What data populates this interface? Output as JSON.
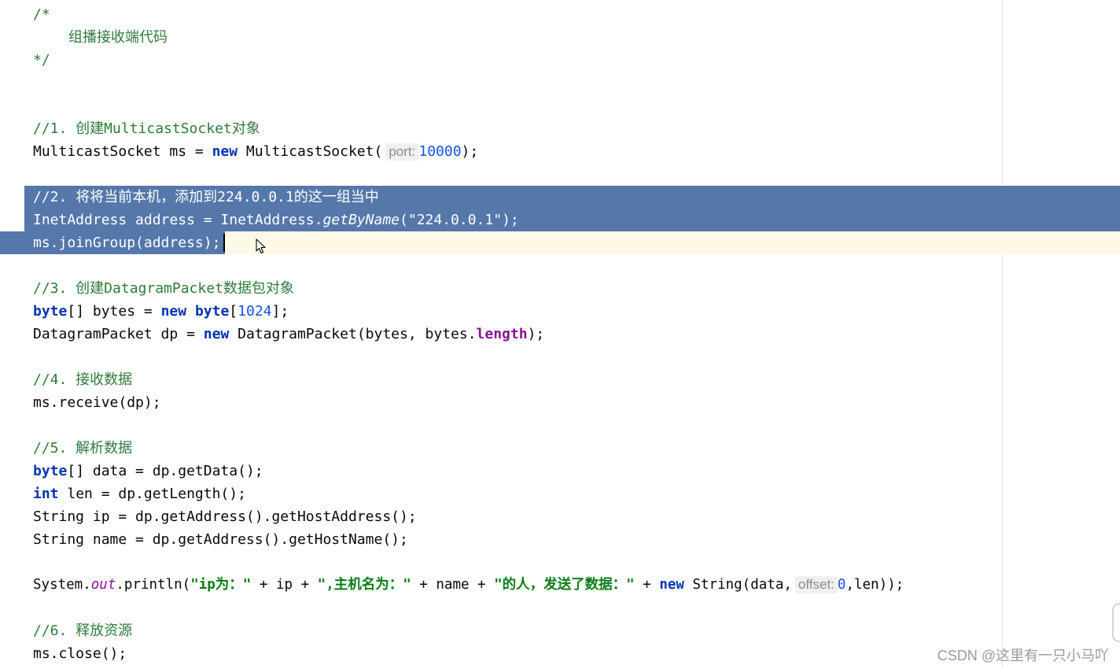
{
  "editor": {
    "lines": {
      "c_open": "/*",
      "c_title": "组播接收端代码",
      "c_close": "*/",
      "step1_comment": "//1. 创建MulticastSocket对象",
      "step1_code": {
        "lhs": "MulticastSocket ms = ",
        "kw_new": "new",
        "ctor": " MulticastSocket(",
        "hint": "port:",
        "value": "10000",
        "end": ");"
      },
      "step2_comment": "//2. 将将当前本机，添加到224.0.0.1的这一组当中",
      "step2_code1": {
        "lhs": "InetAddress address = InetAddress.",
        "method": "getByName",
        "open": "(",
        "str": "\"224.0.0.1\"",
        "end": ");"
      },
      "step2_code2": "ms.joinGroup(address);",
      "step3_comment": "//3. 创建DatagramPacket数据包对象",
      "step3_code1": {
        "kw_byte": "byte",
        "mid": "[] bytes = ",
        "kw_new": "new",
        "sp": " ",
        "kw_byte2": "byte",
        "open": "[",
        "size": "1024",
        "end": "];"
      },
      "step3_code2": {
        "lhs": "DatagramPacket dp = ",
        "kw_new": "new",
        "ctor": " DatagramPacket(bytes, bytes.",
        "field": "length",
        "end": ");"
      },
      "step4_comment": "//4. 接收数据",
      "step4_code": "ms.receive(dp);",
      "step5_comment": "//5. 解析数据",
      "step5_code1": {
        "kw_byte": "byte",
        "rest": "[] data = dp.getData();"
      },
      "step5_code2": {
        "kw_int": "int",
        "rest": " len = dp.getLength();"
      },
      "step5_code3": "String ip = dp.getAddress().getHostAddress();",
      "step5_code4": "String name = dp.getAddress().getHostName();",
      "println": {
        "head": "System.",
        "out": "out",
        "call": ".println(",
        "s1": "\"ip为：\"",
        "p1": " + ip + ",
        "s2": "\",主机名为：\"",
        "p2": " + name + ",
        "s3": "\"的人，发送了数据：\"",
        "p3": " + ",
        "kw_new": "new",
        "ctor": " String(data,",
        "hint": "offset:",
        "zero": "0",
        "end": ",len));"
      },
      "step6_comment": "//6. 释放资源",
      "step6_code": "ms.close();"
    }
  },
  "watermark": "CSDN @这里有一只小马吖",
  "colors": {
    "selection": "#5577aa",
    "caret_line": "#fdf9e6",
    "comment": "#2f7a3a",
    "keyword": "#0033b3",
    "number": "#1750eb",
    "string": "#067d17",
    "field": "#871094"
  },
  "icons": {
    "mouse_cursor": "arrow-cursor-icon"
  }
}
